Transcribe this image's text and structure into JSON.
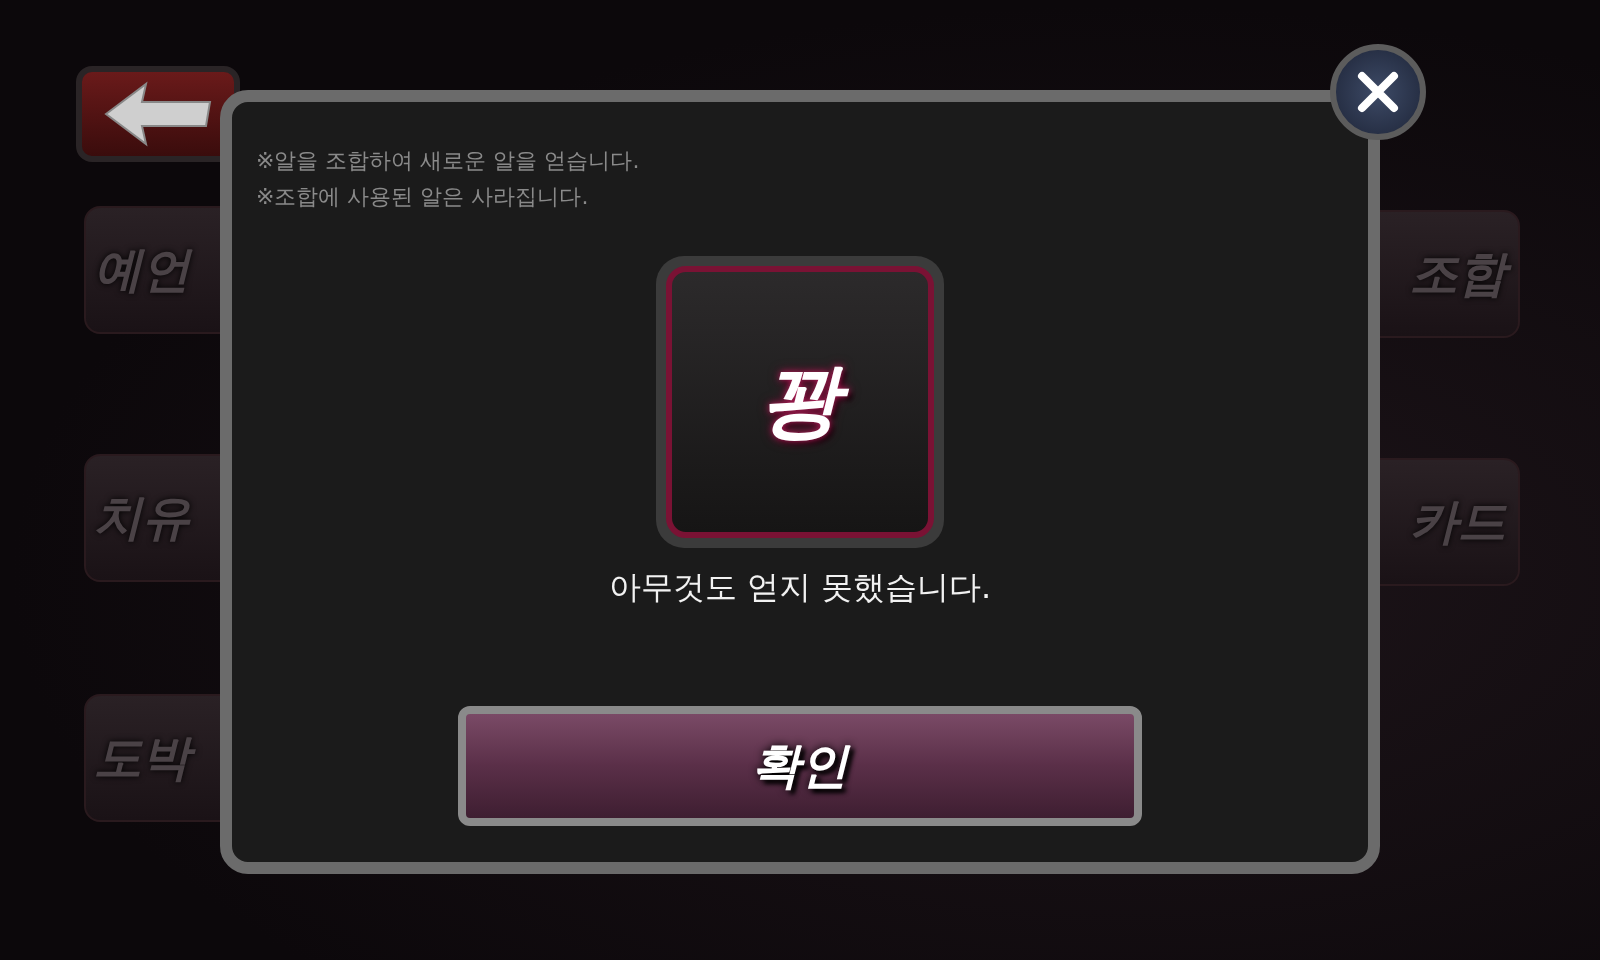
{
  "menu_left": [
    {
      "label": "예언"
    },
    {
      "label": "치유"
    },
    {
      "label": "도박"
    }
  ],
  "menu_right": [
    {
      "label": "조합"
    },
    {
      "label": "카드"
    }
  ],
  "dialog": {
    "notes": [
      "※알을 조합하여 새로운 알을 얻습니다.",
      "※조합에 사용된 알은 사라집니다."
    ],
    "result": "꽝",
    "message": "아무것도 얻지 못했습니다.",
    "confirm_button": "확인"
  }
}
